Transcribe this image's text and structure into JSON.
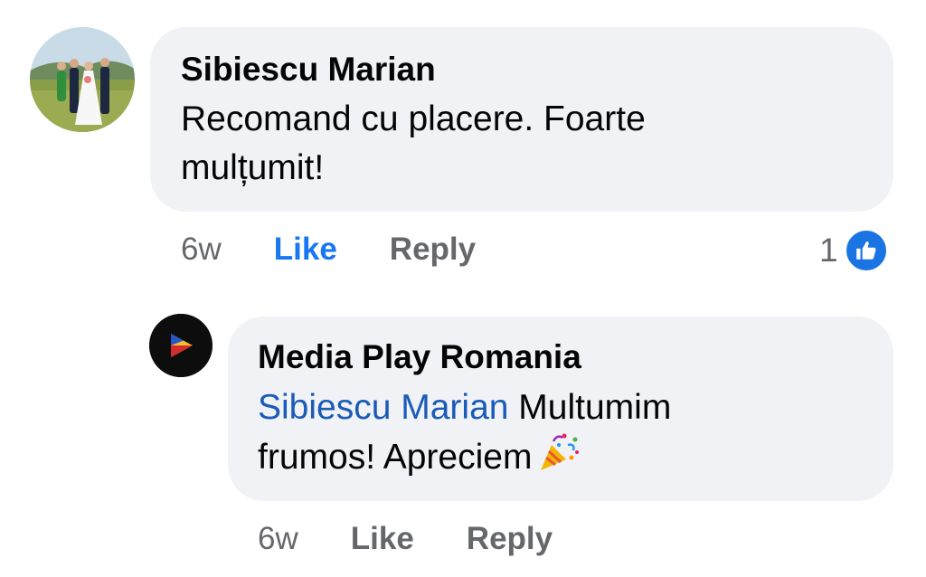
{
  "comment": {
    "author": "Sibiescu Marian",
    "text": "Recomand cu placere. Foarte\nmulțumit!",
    "avatar_icon": "wedding-photo-avatar",
    "time": "6w",
    "like_label": "Like",
    "reply_label": "Reply",
    "like_active": true,
    "reaction_count": "1",
    "reaction_icon": "thumbs-up-icon",
    "like_color": "#1877f2"
  },
  "reply": {
    "author": "Media Play Romania",
    "mention": "Sibiescu Marian",
    "text_line1": " Multumim",
    "text_line2": "frumos! Apreciem",
    "emoji_icon": "party-popper-icon",
    "avatar_icon": "play-triangle-logo",
    "time": "6w",
    "like_label": "Like",
    "reply_label": "Reply",
    "mention_color": "#1a5bb8"
  },
  "colors": {
    "bubble_bg": "#f0f2f5",
    "meta_text": "#65676b",
    "badge_blue": "#1b74e4"
  }
}
